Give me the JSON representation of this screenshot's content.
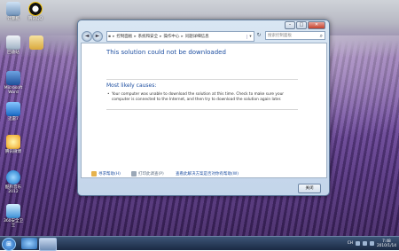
{
  "desktop": {
    "icons": [
      {
        "label": "计算机"
      },
      {
        "label": "腾讯QQ"
      },
      {
        "label": "回收站"
      },
      {
        "label": "Microsoft Word"
      },
      {
        "label": "迅雷7"
      },
      {
        "label": "腾讯微博"
      },
      {
        "label": "酷狗音乐2012"
      },
      {
        "label": "360安全卫士"
      }
    ]
  },
  "window": {
    "address": {
      "segments": [
        "控制面板",
        "系统和安全",
        "操作中心",
        "问题详细信息"
      ]
    },
    "search_placeholder": "搜索控制面板",
    "content": {
      "title": "This solution could not be downloaded",
      "heading": "Most likely causes:",
      "bullet": "Your computer was unable to download the solution at this time. Check to make sure your computer is connected to the Internet, and then try to download the solution again later."
    },
    "footer_links": {
      "help": "寻求帮助(H)",
      "print": "打印此调查(P)",
      "check": "查看此解决方案是否对你有帮助(W)"
    },
    "close_button": "关闭",
    "controls": {
      "minimize": "–",
      "maximize": "□",
      "close": "✕"
    }
  },
  "taskbar": {
    "lang": "CH",
    "time": "7:48",
    "date": "2010/1/14"
  }
}
